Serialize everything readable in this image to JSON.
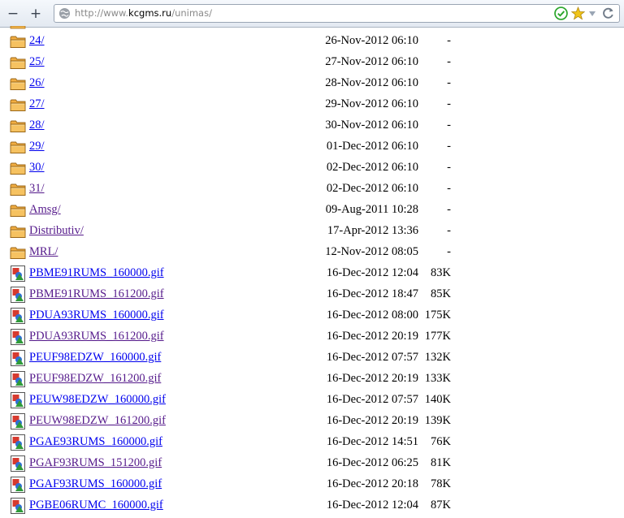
{
  "browser": {
    "url_prefix": "http://www.",
    "url_domain": "kcgms.ru",
    "url_path": "/unimas/",
    "colors": {
      "accent_green": "#2aa52a",
      "star": "#f0c419"
    }
  },
  "listing": {
    "rows": [
      {
        "name": "24/",
        "date": "26-Nov-2012 06:10",
        "size": "-",
        "type": "folder",
        "visited": false
      },
      {
        "name": "25/",
        "date": "27-Nov-2012 06:10",
        "size": "-",
        "type": "folder",
        "visited": false
      },
      {
        "name": "26/",
        "date": "28-Nov-2012 06:10",
        "size": "-",
        "type": "folder",
        "visited": false
      },
      {
        "name": "27/",
        "date": "29-Nov-2012 06:10",
        "size": "-",
        "type": "folder",
        "visited": false
      },
      {
        "name": "28/",
        "date": "30-Nov-2012 06:10",
        "size": "-",
        "type": "folder",
        "visited": false
      },
      {
        "name": "29/",
        "date": "01-Dec-2012 06:10",
        "size": "-",
        "type": "folder",
        "visited": false
      },
      {
        "name": "30/",
        "date": "02-Dec-2012 06:10",
        "size": "-",
        "type": "folder",
        "visited": false
      },
      {
        "name": "31/",
        "date": "02-Dec-2012 06:10",
        "size": "-",
        "type": "folder",
        "visited": true
      },
      {
        "name": "Amsg/",
        "date": "09-Aug-2011 10:28",
        "size": "-",
        "type": "folder",
        "visited": true
      },
      {
        "name": "Distributiv/",
        "date": "17-Apr-2012 13:36",
        "size": "-",
        "type": "folder",
        "visited": true
      },
      {
        "name": "MRL/",
        "date": "12-Nov-2012 08:05",
        "size": "-",
        "type": "folder",
        "visited": true
      },
      {
        "name": "PBME91RUMS_160000.gif",
        "date": "16-Dec-2012 12:04",
        "size": "83K",
        "type": "image",
        "visited": false
      },
      {
        "name": "PBME91RUMS_161200.gif",
        "date": "16-Dec-2012 18:47",
        "size": "85K",
        "type": "image",
        "visited": true
      },
      {
        "name": "PDUA93RUMS_160000.gif",
        "date": "16-Dec-2012 08:00",
        "size": "175K",
        "type": "image",
        "visited": false
      },
      {
        "name": "PDUA93RUMS_161200.gif",
        "date": "16-Dec-2012 20:19",
        "size": "177K",
        "type": "image",
        "visited": true
      },
      {
        "name": "PEUF98EDZW_160000.gif",
        "date": "16-Dec-2012 07:57",
        "size": "132K",
        "type": "image",
        "visited": false
      },
      {
        "name": "PEUF98EDZW_161200.gif",
        "date": "16-Dec-2012 20:19",
        "size": "133K",
        "type": "image",
        "visited": true
      },
      {
        "name": "PEUW98EDZW_160000.gif",
        "date": "16-Dec-2012 07:57",
        "size": "140K",
        "type": "image",
        "visited": false
      },
      {
        "name": "PEUW98EDZW_161200.gif",
        "date": "16-Dec-2012 20:19",
        "size": "139K",
        "type": "image",
        "visited": true
      },
      {
        "name": "PGAE93RUMS_160000.gif",
        "date": "16-Dec-2012 14:51",
        "size": "76K",
        "type": "image",
        "visited": false
      },
      {
        "name": "PGAF93RUMS_151200.gif",
        "date": "16-Dec-2012 06:25",
        "size": "81K",
        "type": "image",
        "visited": true
      },
      {
        "name": "PGAF93RUMS_160000.gif",
        "date": "16-Dec-2012 20:18",
        "size": "78K",
        "type": "image",
        "visited": false
      },
      {
        "name": "PGBE06RUMC_160000.gif",
        "date": "16-Dec-2012 12:04",
        "size": "87K",
        "type": "image",
        "visited": false
      }
    ]
  }
}
